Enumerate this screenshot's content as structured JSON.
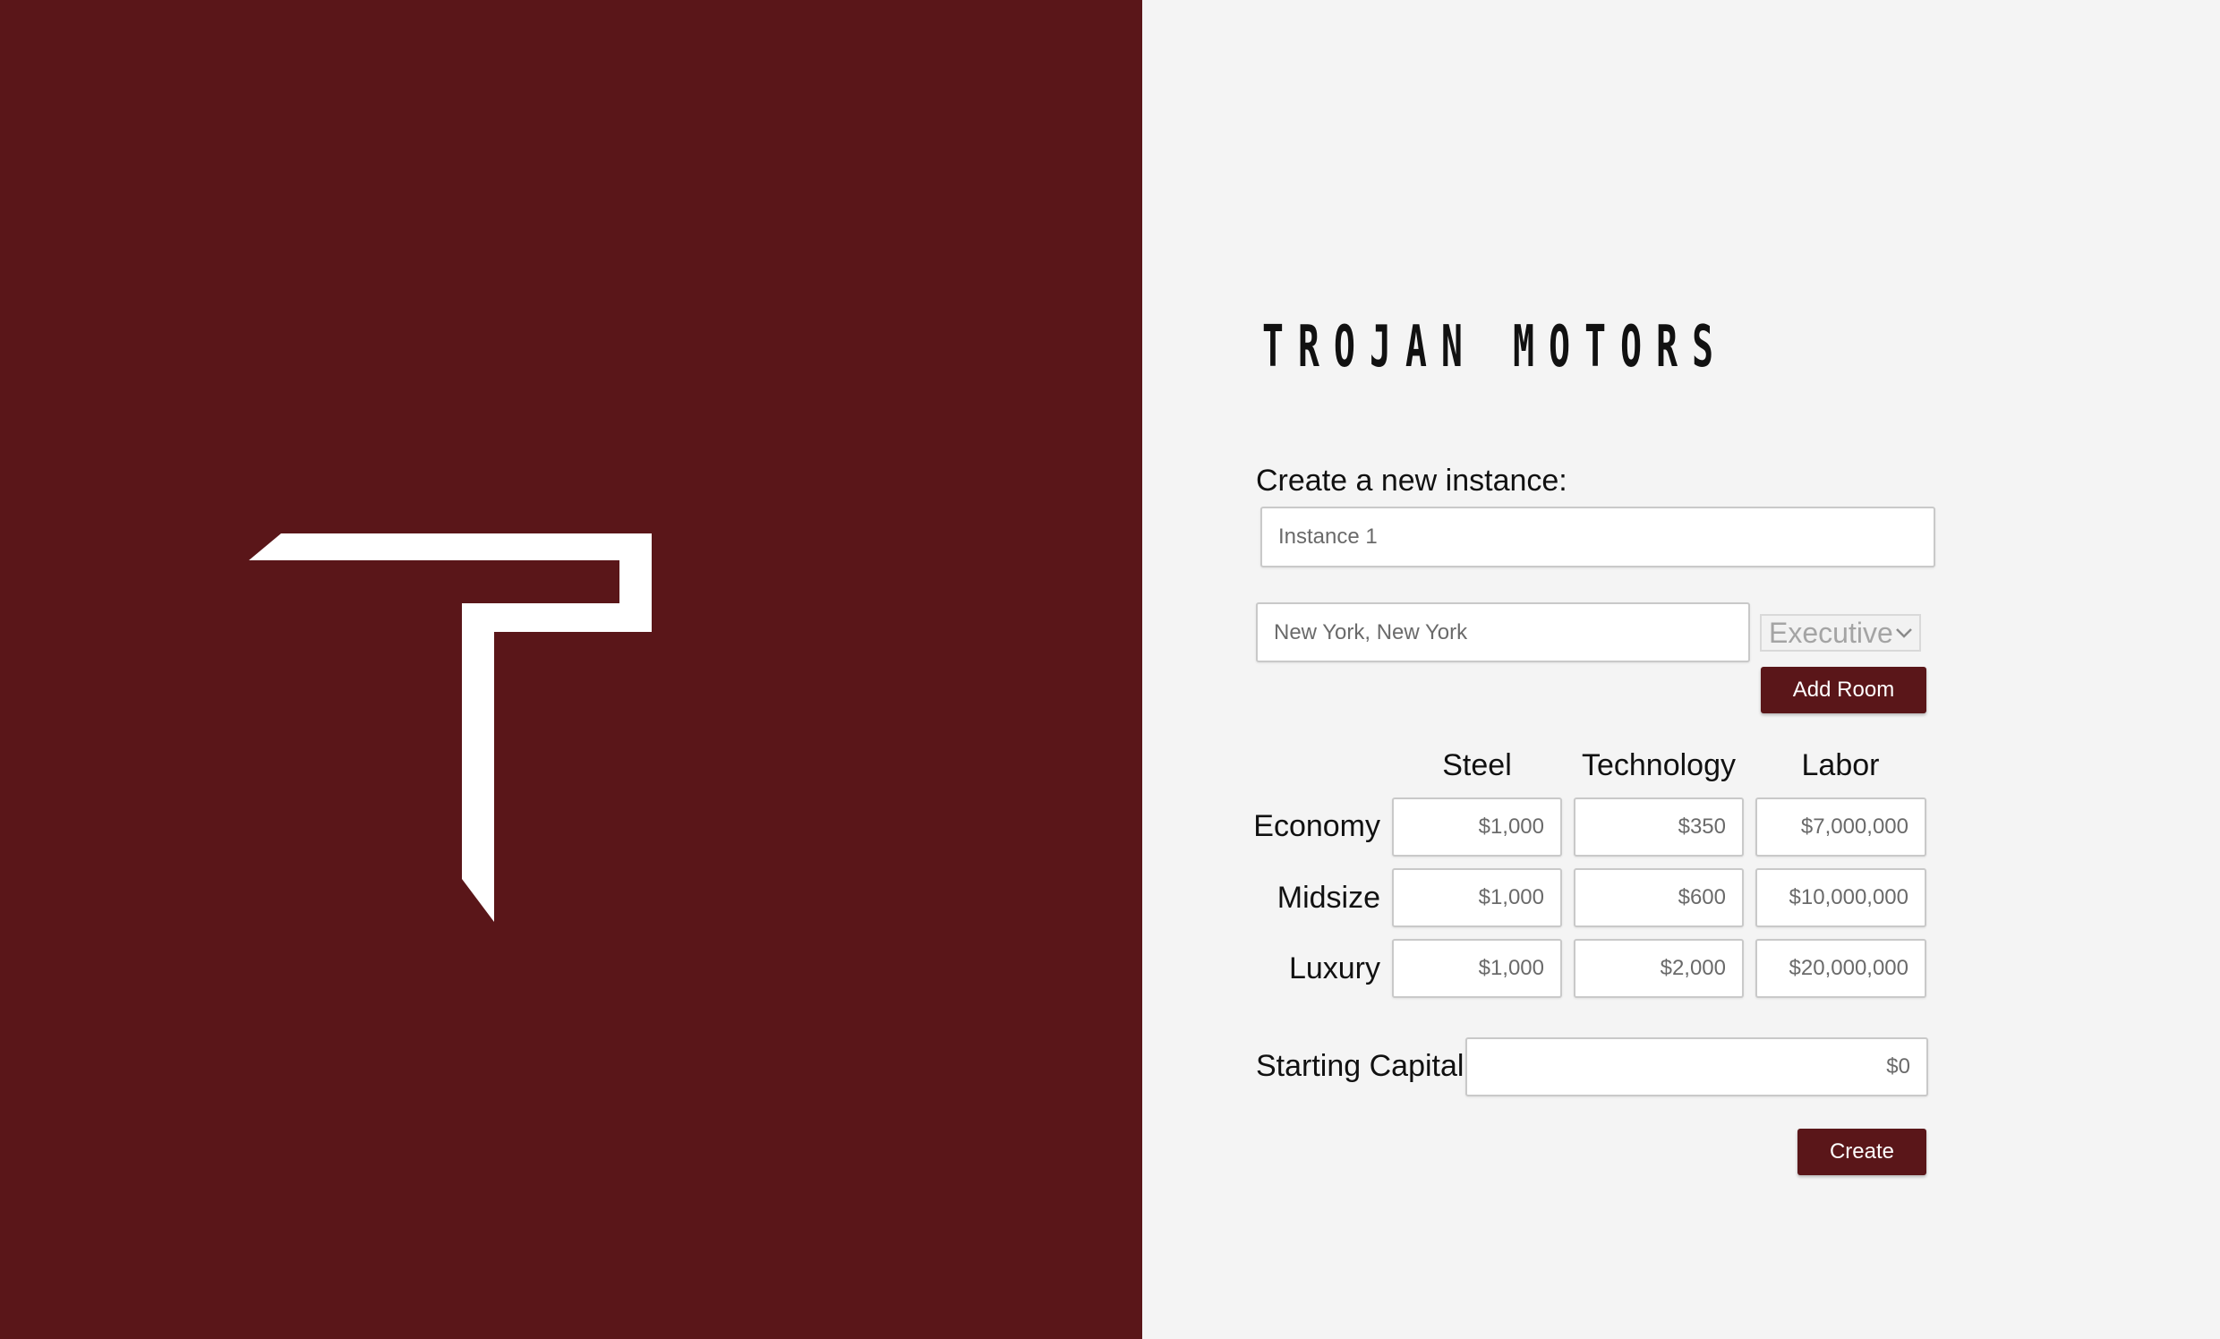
{
  "brand": {
    "name": "TROJAN MOTORS"
  },
  "logo": {
    "icon": "trojan-t-logo-icon",
    "color": "#ffffff"
  },
  "colors": {
    "accent": "#5a1619",
    "panel_bg": "#f4f4f4"
  },
  "create_form": {
    "label": "Create a new instance:",
    "instance_name_placeholder": "Instance 1",
    "location_placeholder": "New York, New York",
    "room_type_selected": "Executive",
    "add_room_label": "Add Room"
  },
  "cost_table": {
    "columns": [
      "Steel",
      "Technology",
      "Labor"
    ],
    "rows": [
      {
        "label": "Economy",
        "values": [
          "$1,000",
          "$350",
          "$7,000,000"
        ]
      },
      {
        "label": "Midsize",
        "values": [
          "$1,000",
          "$600",
          "$10,000,000"
        ]
      },
      {
        "label": "Luxury",
        "values": [
          "$1,000",
          "$2,000",
          "$20,000,000"
        ]
      }
    ]
  },
  "starting_capital": {
    "label": "Starting Capital",
    "placeholder": "$0"
  },
  "create_button_label": "Create"
}
